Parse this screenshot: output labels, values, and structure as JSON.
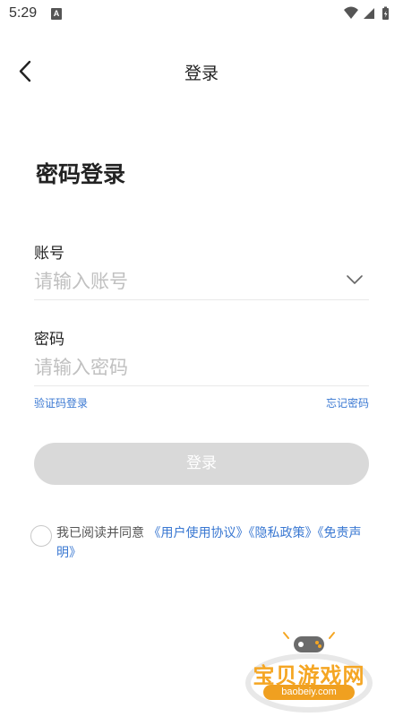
{
  "status_bar": {
    "time": "5:29",
    "badge": "A",
    "icons": [
      "wifi-icon",
      "signal-icon",
      "battery-icon"
    ]
  },
  "header": {
    "title": "登录",
    "back_icon": "chevron-left-icon"
  },
  "page_title": "密码登录",
  "account": {
    "label": "账号",
    "placeholder": "请输入账号",
    "value": "",
    "dropdown_icon": "chevron-down-icon"
  },
  "password": {
    "label": "密码",
    "placeholder": "请输入密码",
    "value": ""
  },
  "links": {
    "sms_login": "验证码登录",
    "forgot_password": "忘记密码"
  },
  "login_button": "登录",
  "agreement": {
    "checked": false,
    "prefix": "我已阅读并同意",
    "terms": "《用户使用协议》",
    "privacy": "《隐私政策》",
    "disclaimer": "《免责声明》"
  },
  "watermark": {
    "brand": "宝贝游戏网",
    "url": "baobeiy.com"
  },
  "colors": {
    "link": "#3a78d2",
    "button_disabled": "#d9d9d9",
    "placeholder": "#c0c0c0",
    "watermark": "#f5a623"
  }
}
